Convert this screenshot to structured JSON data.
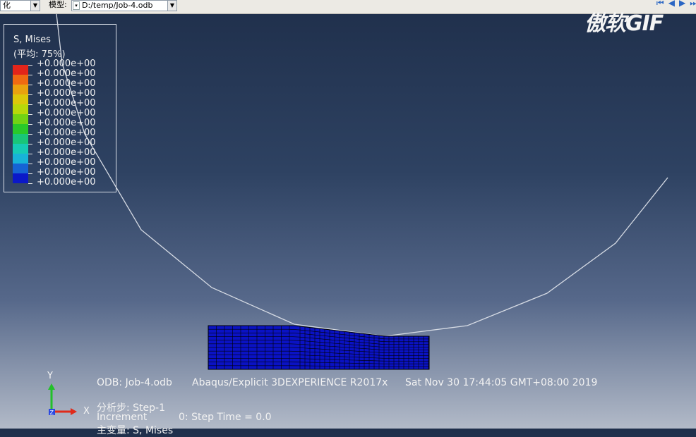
{
  "toolbar": {
    "left_combo_value": "化",
    "model_label": "模型:",
    "model_combo_value": "D:/temp/Job-4.odb",
    "playback": {
      "first_glyph": "⏮",
      "prev_glyph": "◀",
      "next_glyph": "▶",
      "last_glyph": "⏭"
    }
  },
  "watermark": {
    "text": "傲软GIF"
  },
  "legend": {
    "title": "S, Mises",
    "subtitle": "(平均: 75%)",
    "entries": [
      {
        "value": "+0.000e+00",
        "color": "#e3251a"
      },
      {
        "value": "+0.000e+00",
        "color": "#ef6a12"
      },
      {
        "value": "+0.000e+00",
        "color": "#e9a20f"
      },
      {
        "value": "+0.000e+00",
        "color": "#dcc80a"
      },
      {
        "value": "+0.000e+00",
        "color": "#b8d80a"
      },
      {
        "value": "+0.000e+00",
        "color": "#72d314"
      },
      {
        "value": "+0.000e+00",
        "color": "#29c92a"
      },
      {
        "value": "+0.000e+00",
        "color": "#19c679"
      },
      {
        "value": "+0.000e+00",
        "color": "#16cbb5"
      },
      {
        "value": "+0.000e+00",
        "color": "#18b3d8"
      },
      {
        "value": "+0.000e+00",
        "color": "#1663d4"
      },
      {
        "value": "+0.000e+00",
        "color": "#0b18c8"
      },
      {
        "value": "+0.000e+00",
        "color": ""
      }
    ]
  },
  "viewport": {
    "mesh_color": "#0a12c4",
    "mesh_line_color": "#000000",
    "contact_line_color": "#d6dbe4"
  },
  "info": {
    "odb": "ODB: Job-4.odb",
    "solver": "Abaqus/Explicit 3DEXPERIENCE R2017x",
    "date": "Sat Nov 30 17:44:05 GMT+08:00 2019",
    "step": "分析步: Step-1",
    "increment_label": "Increment",
    "increment_value": "0: Step Time =    0.0",
    "primary_var": "主变量: S, Mises"
  },
  "triad": {
    "y_label": "Y",
    "x_label": "X",
    "z_label": "Z",
    "y_color": "#22c02a",
    "x_color": "#e02a1a",
    "z_color": "#2a48e0"
  }
}
